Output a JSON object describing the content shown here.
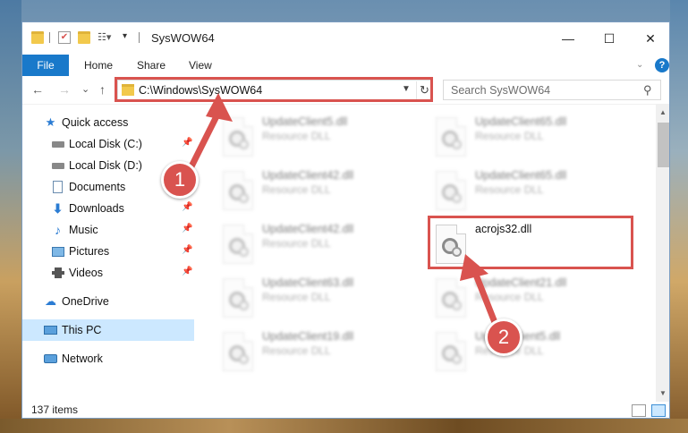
{
  "window": {
    "title": "SysWOW64",
    "minimize_glyph": "—",
    "maximize_glyph": "☐",
    "close_glyph": "✕"
  },
  "ribbon": {
    "tabs": [
      "File",
      "Home",
      "Share",
      "View"
    ],
    "help_glyph": "?"
  },
  "nav": {
    "back_glyph": "←",
    "forward_glyph": "→",
    "recent_glyph": "⌄",
    "up_glyph": "↑",
    "address": "C:\\Windows\\SysWOW64",
    "search_placeholder": "Search SysWOW64"
  },
  "sidebar": {
    "items": [
      {
        "label": "Quick access",
        "icon": "star-icon",
        "pinned": false
      },
      {
        "label": "Local Disk (C:)",
        "icon": "drive-icon",
        "pinned": true
      },
      {
        "label": "Local Disk (D:)",
        "icon": "drive-icon",
        "pinned": false
      },
      {
        "label": "Documents",
        "icon": "documents-icon",
        "pinned": true
      },
      {
        "label": "Downloads",
        "icon": "download-icon",
        "pinned": true
      },
      {
        "label": "Music",
        "icon": "music-icon",
        "pinned": true
      },
      {
        "label": "Pictures",
        "icon": "pictures-icon",
        "pinned": true
      },
      {
        "label": "Videos",
        "icon": "videos-icon",
        "pinned": true
      },
      {
        "label": "OneDrive",
        "icon": "cloud-icon",
        "pinned": false
      },
      {
        "label": "This PC",
        "icon": "computer-icon",
        "pinned": false,
        "selected": true
      },
      {
        "label": "Network",
        "icon": "network-icon",
        "pinned": false
      }
    ]
  },
  "files": [
    {
      "name": "UpdateClient5.dll",
      "type": "Resource DLL",
      "blurred": true
    },
    {
      "name": "UpdateClient65.dll",
      "type": "Resource DLL",
      "blurred": true
    },
    {
      "name": "UpdateClient42.dll",
      "type": "Resource DLL",
      "blurred": true
    },
    {
      "name": "UpdateClient65.dll",
      "type": "Resource DLL",
      "blurred": true
    },
    {
      "name": "UpdateClient42.dll",
      "type": "Resource DLL",
      "blurred": true
    },
    {
      "name": "acrojs32.dll",
      "type": "",
      "blurred": false
    },
    {
      "name": "UpdateClient63.dll",
      "type": "Resource DLL",
      "blurred": true
    },
    {
      "name": "UpdateClient21.dll",
      "type": "Resource DLL",
      "blurred": true
    },
    {
      "name": "UpdateClient19.dll",
      "type": "Resource DLL",
      "blurred": true
    },
    {
      "name": "UpdateClient5.dll",
      "type": "Resource DLL",
      "blurred": true
    }
  ],
  "status": {
    "item_count": "137 items"
  },
  "annotations": {
    "step1": "1",
    "step2": "2",
    "color": "#d9534f"
  }
}
